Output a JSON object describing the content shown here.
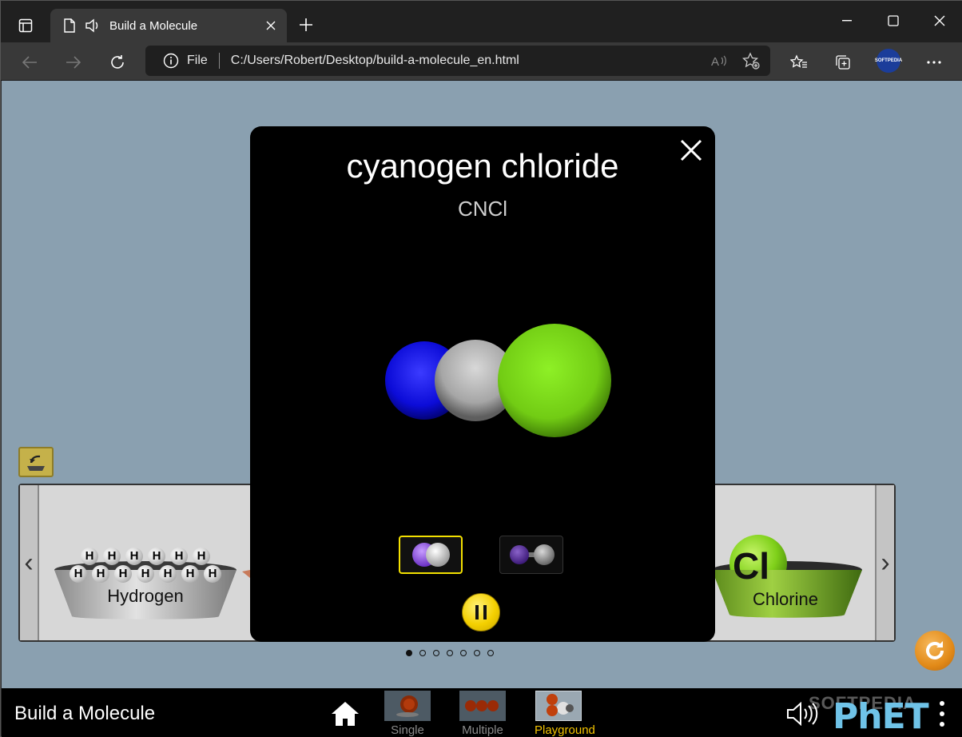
{
  "browser": {
    "tab_title": "Build a Molecule",
    "file_label": "File",
    "url": "C:/Users/Robert/Desktop/build-a-molecule_en.html",
    "profile_label": "SOFTPEDIA"
  },
  "kits": {
    "buckets": [
      {
        "label": "Hydrogen",
        "atom_symbol": "H"
      },
      {
        "label": "Chlorine",
        "atom_symbol": "Cl"
      }
    ],
    "page_dots": 7,
    "active_page": 1
  },
  "dialog": {
    "title": "cyanogen chloride",
    "formula": "CNCl",
    "view_modes": [
      "space-filling",
      "ball-and-stick"
    ],
    "selected_view": "space-filling",
    "playing": true
  },
  "navbar": {
    "sim_title": "Build a Molecule",
    "screens": [
      {
        "label": "Single",
        "selected": false
      },
      {
        "label": "Multiple",
        "selected": false
      },
      {
        "label": "Playground",
        "selected": true
      }
    ],
    "logo_text": "PhET",
    "watermark": "SOFTPEDIA"
  },
  "colors": {
    "nitrogen": "#1010e0",
    "carbon": "#b0b0b0",
    "chlorine": "#7fe01a",
    "selected_label": "#f3c300",
    "play_area": "#8aa0b0"
  }
}
